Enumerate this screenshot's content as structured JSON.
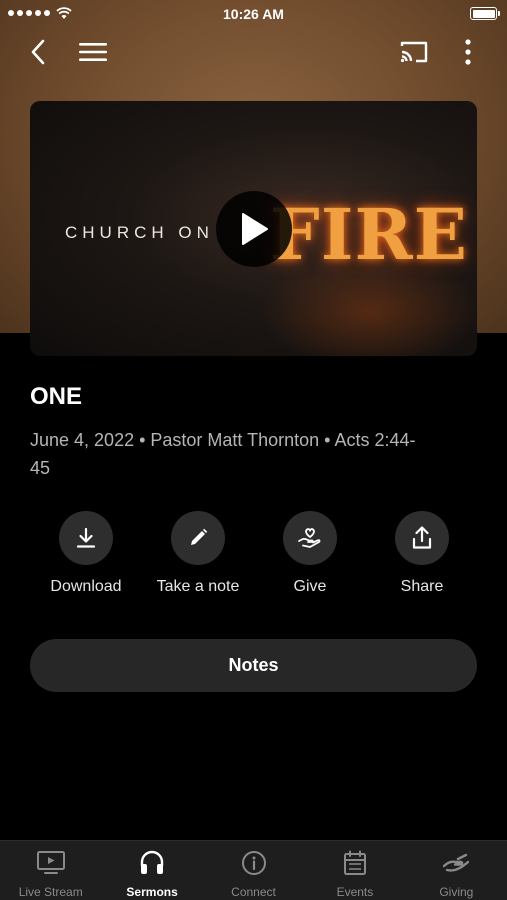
{
  "status_bar": {
    "time": "10:26 AM",
    "signal_icon": "signal-dots-icon",
    "wifi_icon": "wifi-icon",
    "battery_icon": "battery-icon"
  },
  "nav": {
    "back_icon": "chevron-left-icon",
    "menu_icon": "hamburger-menu-icon",
    "cast_icon": "cast-icon",
    "more_icon": "more-vertical-icon"
  },
  "hero": {
    "text_left": "CHURCH ON",
    "text_right": "FIRE",
    "play_icon": "play-icon"
  },
  "sermon": {
    "title": "ONE",
    "meta": "June 4, 2022 • Pastor Matt Thornton • Acts 2:44-45"
  },
  "actions": [
    {
      "label": "Download",
      "icon": "download-icon"
    },
    {
      "label": "Take a note",
      "icon": "pencil-icon"
    },
    {
      "label": "Give",
      "icon": "heart-hand-icon"
    },
    {
      "label": "Share",
      "icon": "share-icon"
    }
  ],
  "notes_button": {
    "label": "Notes"
  },
  "tabs": [
    {
      "label": "Live Stream",
      "icon": "tv-play-icon",
      "active": false
    },
    {
      "label": "Sermons",
      "icon": "headphones-icon",
      "active": true
    },
    {
      "label": "Connect",
      "icon": "info-circle-icon",
      "active": false
    },
    {
      "label": "Events",
      "icon": "calendar-icon",
      "active": false
    },
    {
      "label": "Giving",
      "icon": "giving-hand-icon",
      "active": false
    }
  ],
  "colors": {
    "background": "#000000",
    "header_brown": "#6e4a2c",
    "surface": "#272727",
    "tab_active": "#ffffff",
    "tab_inactive": "#8a8a8a"
  }
}
